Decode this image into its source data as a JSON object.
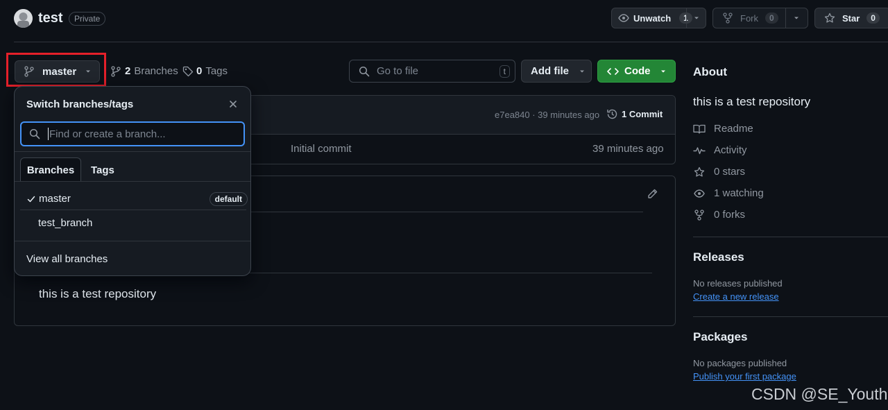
{
  "repo": {
    "name": "test",
    "visibility": "Private"
  },
  "header": {
    "unwatch_label": "Unwatch",
    "unwatch_count": "1",
    "fork_label": "Fork",
    "fork_count": "0",
    "star_label": "Star",
    "star_count": "0"
  },
  "toolbar": {
    "branch": "master",
    "branches_count": "2",
    "branches_label": "Branches",
    "tags_count": "0",
    "tags_label": "Tags",
    "go_to_file_placeholder": "Go to file",
    "go_to_file_key": "t",
    "add_file_label": "Add file",
    "code_label": "Code"
  },
  "commit_bar": {
    "hash_time": "e7ea840 · 39 minutes ago",
    "commits_label": "1 Commit"
  },
  "file_row": {
    "message": "Initial commit",
    "time": "39 minutes ago"
  },
  "readme": {
    "body": "this is a test repository"
  },
  "dropdown": {
    "title": "Switch branches/tags",
    "search_placeholder": "Find or create a branch...",
    "tabs": [
      "Branches",
      "Tags"
    ],
    "branches": [
      {
        "name": "master",
        "selected": true,
        "badge": "default"
      },
      {
        "name": "test_branch",
        "selected": false,
        "badge": ""
      }
    ],
    "footer_link": "View all branches"
  },
  "about": {
    "heading": "About",
    "description": "this is a test repository",
    "items": [
      {
        "icon": "book-icon",
        "label": "Readme"
      },
      {
        "icon": "pulse-icon",
        "label": "Activity"
      },
      {
        "icon": "star-icon",
        "label": "0 stars"
      },
      {
        "icon": "eye-icon",
        "label": "1 watching"
      },
      {
        "icon": "fork-icon",
        "label": "0 forks"
      }
    ]
  },
  "releases": {
    "heading": "Releases",
    "empty": "No releases published",
    "link": "Create a new release"
  },
  "packages": {
    "heading": "Packages",
    "empty": "No packages published",
    "link": "Publish your first package"
  },
  "watermark": "CSDN @SE_Youth",
  "colors": {
    "background": "#0d1117",
    "code_button": "#238636",
    "link": "#4493f8",
    "highlight": "#e5202a",
    "focus": "#1f6feb"
  }
}
